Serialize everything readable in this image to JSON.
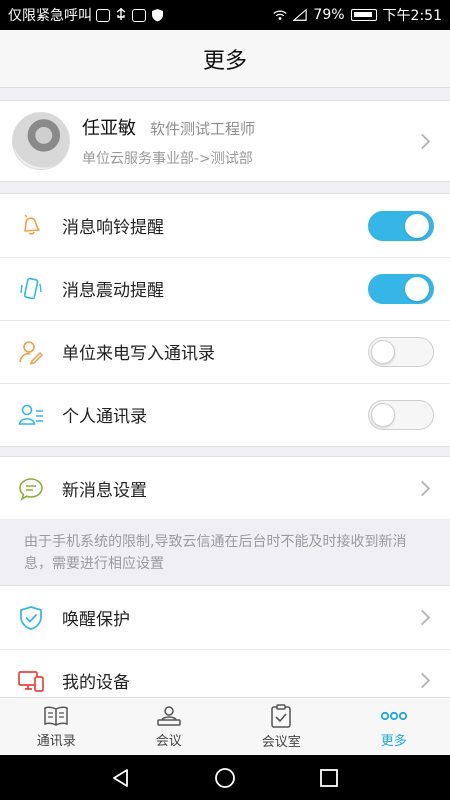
{
  "status_bar": {
    "carrier": "仅限紧急呼叫",
    "battery": "79%",
    "time": "下午2:51"
  },
  "header": {
    "title": "更多"
  },
  "profile": {
    "name": "任亚敏",
    "role": "软件测试工程师",
    "department": "单位云服务事业部->测试部"
  },
  "toggles": [
    {
      "label": "消息响铃提醒",
      "on": true,
      "icon": "bell-icon"
    },
    {
      "label": "消息震动提醒",
      "on": true,
      "icon": "vibrate-icon"
    },
    {
      "label": "单位来电写入通讯录",
      "on": false,
      "icon": "contact-edit-icon"
    },
    {
      "label": "个人通讯录",
      "on": false,
      "icon": "personal-contacts-icon"
    }
  ],
  "new_message": {
    "label": "新消息设置",
    "icon": "message-bubble-icon"
  },
  "note": "由于手机系统的限制,导致云信通在后台时不能及时接收到新消息，需要进行相应设置",
  "more_items": [
    {
      "label": "唤醒保护",
      "icon": "shield-check-icon"
    },
    {
      "label": "我的设备",
      "icon": "devices-icon"
    }
  ],
  "tabs": [
    {
      "label": "通讯录",
      "icon": "book-icon",
      "active": false
    },
    {
      "label": "会议",
      "icon": "meeting-icon",
      "active": false
    },
    {
      "label": "会议室",
      "icon": "clipboard-icon",
      "active": false
    },
    {
      "label": "更多",
      "icon": "more-dots-icon",
      "active": true
    }
  ],
  "colors": {
    "accent": "#35b6e6",
    "orange": "#f0a04b",
    "red": "#e8453c"
  }
}
